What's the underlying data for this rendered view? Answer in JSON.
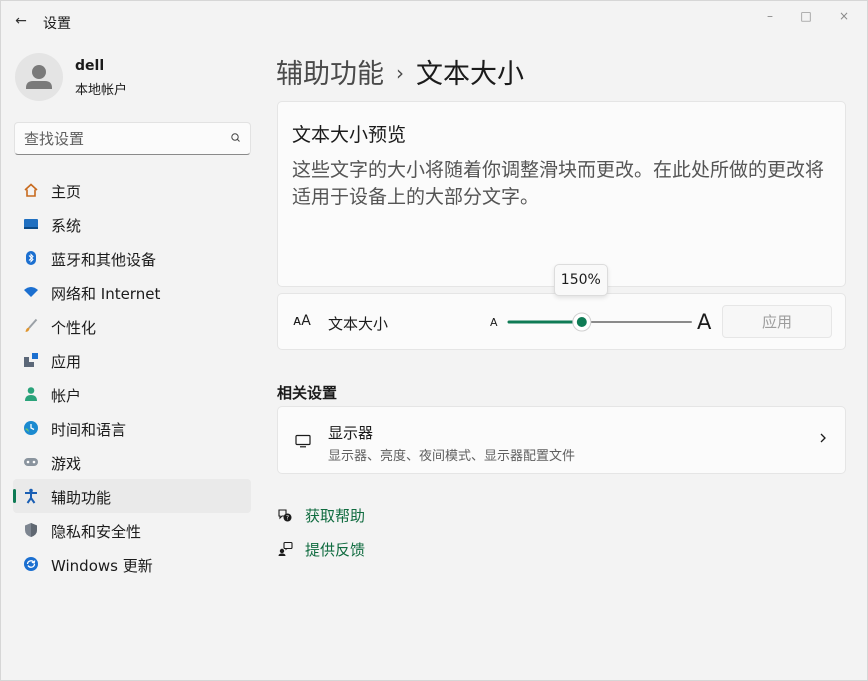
{
  "window": {
    "title": "设置",
    "controls": {
      "minimize": "–",
      "maximize": "□",
      "close": "×"
    }
  },
  "profile": {
    "name": "dell",
    "account_type": "本地帐户"
  },
  "search": {
    "placeholder": "查找设置"
  },
  "sidebar": {
    "items": [
      {
        "label": "主页",
        "icon": "home-icon"
      },
      {
        "label": "系统",
        "icon": "system-icon"
      },
      {
        "label": "蓝牙和其他设备",
        "icon": "bluetooth-icon"
      },
      {
        "label": "网络和 Internet",
        "icon": "network-icon"
      },
      {
        "label": "个性化",
        "icon": "brush-icon"
      },
      {
        "label": "应用",
        "icon": "apps-icon"
      },
      {
        "label": "帐户",
        "icon": "account-icon"
      },
      {
        "label": "时间和语言",
        "icon": "globe-clock-icon"
      },
      {
        "label": "游戏",
        "icon": "gamepad-icon"
      },
      {
        "label": "辅助功能",
        "icon": "accessibility-icon",
        "active": true
      },
      {
        "label": "隐私和安全性",
        "icon": "shield-icon"
      },
      {
        "label": "Windows 更新",
        "icon": "update-icon"
      }
    ]
  },
  "breadcrumb": {
    "parent": "辅助功能",
    "separator": "›",
    "current": "文本大小"
  },
  "preview": {
    "title": "文本大小预览",
    "text": "这些文字的大小将随着你调整滑块而更改。在此处所做的更改将适用于设备上的大部分文字。"
  },
  "text_size": {
    "icon_glyph": "ᴀA",
    "label": "文本大小",
    "small_a": "A",
    "large_a": "A",
    "value_percent": 150,
    "value_label": "150%",
    "min_percent": 100,
    "max_percent": 225,
    "apply_label": "应用"
  },
  "related": {
    "title": "相关设置",
    "display": {
      "title": "显示器",
      "subtitle": "显示器、亮度、夜间模式、显示器配置文件"
    }
  },
  "links": {
    "help": "获取帮助",
    "feedback": "提供反馈"
  },
  "colors": {
    "accent": "#0f7b55",
    "link": "#0f6b3f",
    "track": "#8a8a8a"
  }
}
